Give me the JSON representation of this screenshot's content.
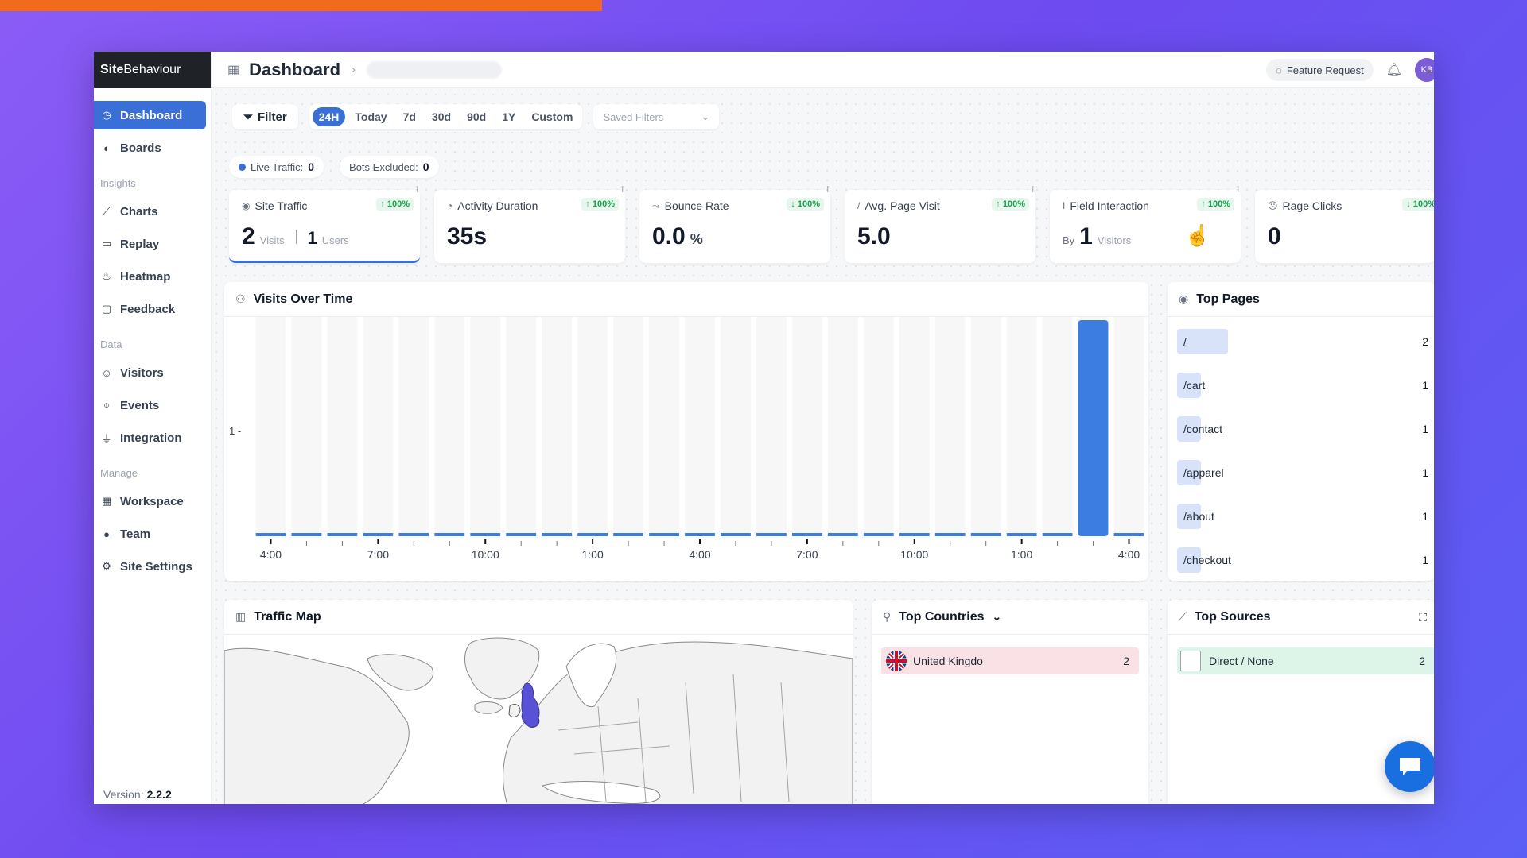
{
  "brand": {
    "part1": "Site",
    "part2": "Behaviour"
  },
  "sidebar": {
    "items": [
      {
        "label": "Dashboard",
        "icon": "dashboard-icon"
      },
      {
        "label": "Boards",
        "icon": "palette-icon"
      }
    ],
    "sections": [
      {
        "title": "Insights",
        "items": [
          {
            "label": "Charts",
            "icon": "chart-line-icon"
          },
          {
            "label": "Replay",
            "icon": "video-icon"
          },
          {
            "label": "Heatmap",
            "icon": "flame-icon"
          },
          {
            "label": "Feedback",
            "icon": "message-icon"
          }
        ]
      },
      {
        "title": "Data",
        "items": [
          {
            "label": "Visitors",
            "icon": "smile-icon"
          },
          {
            "label": "Events",
            "icon": "mouse-icon"
          },
          {
            "label": "Integration",
            "icon": "plug-icon"
          }
        ]
      },
      {
        "title": "Manage",
        "items": [
          {
            "label": "Workspace",
            "icon": "building-icon"
          },
          {
            "label": "Team",
            "icon": "user-icon"
          },
          {
            "label": "Site Settings",
            "icon": "gear-icon"
          }
        ]
      }
    ],
    "version_label": "Version:",
    "version": "2.2.2"
  },
  "header": {
    "title": "Dashboard",
    "feature_request": "Feature Request",
    "avatar_initials": "KB"
  },
  "filters": {
    "filter_label": "Filter",
    "ranges": [
      "24H",
      "Today",
      "7d",
      "30d",
      "90d",
      "1Y",
      "Custom"
    ],
    "active_range": "24H",
    "saved_filters_placeholder": "Saved Filters"
  },
  "status": {
    "live_label": "Live Traffic:",
    "live_value": "0",
    "bots_label": "Bots Excluded:",
    "bots_value": "0"
  },
  "stats": {
    "site_traffic": {
      "label": "Site Traffic",
      "trend": "↑ 100%",
      "visits": "2",
      "visits_unit": "Visits",
      "users": "1",
      "users_unit": "Users"
    },
    "activity": {
      "label": "Activity Duration",
      "trend": "↑ 100%",
      "value": "35s"
    },
    "bounce": {
      "label": "Bounce Rate",
      "trend": "↓ 100%",
      "value": "0.0",
      "unit": "%"
    },
    "avg_page": {
      "label": "Avg. Page Visit",
      "trend": "↑ 100%",
      "value": "5.0"
    },
    "field": {
      "label": "Field Interaction",
      "trend": "↑ 100%",
      "by": "By",
      "value": "1",
      "unit": "Visitors"
    },
    "rage": {
      "label": "Rage Clicks",
      "trend": "↓ 100%",
      "value": "0"
    }
  },
  "visits_panel": {
    "title": "Visits Over Time",
    "chart_data": {
      "type": "bar",
      "bar_count": 25,
      "values": [
        0,
        0,
        0,
        0,
        0,
        0,
        0,
        0,
        0,
        0,
        0,
        0,
        0,
        0,
        0,
        0,
        0,
        0,
        0,
        0,
        0,
        0,
        0,
        1,
        0
      ],
      "y_tick": "1 -",
      "x_labels": [
        "4:00",
        "7:00",
        "10:00",
        "1:00",
        "4:00",
        "7:00",
        "10:00",
        "1:00",
        "4:00"
      ],
      "color": "#3b7de0"
    }
  },
  "top_pages": {
    "title": "Top Pages",
    "items": [
      {
        "path": "/",
        "count": "2",
        "share": 1.0
      },
      {
        "path": "/cart",
        "count": "1",
        "share": 0.5
      },
      {
        "path": "/contact",
        "count": "1",
        "share": 0.5
      },
      {
        "path": "/apparel",
        "count": "1",
        "share": 0.5
      },
      {
        "path": "/about",
        "count": "1",
        "share": 0.5
      },
      {
        "path": "/checkout",
        "count": "1",
        "share": 0.5
      }
    ]
  },
  "traffic_map": {
    "title": "Traffic Map",
    "highlight_color": "#5a52d6"
  },
  "top_countries": {
    "title": "Top Countries",
    "items": [
      {
        "name": "United Kingdo",
        "count": "2"
      }
    ]
  },
  "top_sources": {
    "title": "Top Sources",
    "items": [
      {
        "name": "Direct / None",
        "count": "2"
      }
    ]
  }
}
